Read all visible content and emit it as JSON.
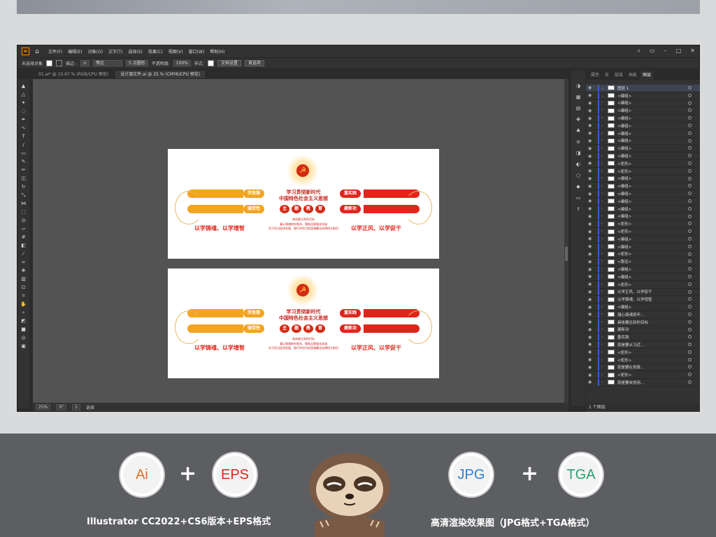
{
  "menu": [
    "文件(F)",
    "编辑(E)",
    "对象(O)",
    "文字(T)",
    "选择(S)",
    "效果(C)",
    "视图(V)",
    "窗口(W)",
    "帮助(H)"
  ],
  "control": {
    "none_selected": "未选择对象",
    "stroke": "描边 :",
    "stroke_val": "≎",
    "opacity_label": "不透明度:",
    "opacity": "100%",
    "style": "样式:",
    "brush": "5 点圆形",
    "uniform": "等比",
    "doc_setup": "文档设置",
    "prefs": "首选项"
  },
  "tabs": [
    "01.ai* @ 15.67 % (RGB/CPU 预览)",
    "设计源文件.ai @ 25 % (CMYK/CPU 预览)"
  ],
  "status": {
    "zoom": "25%",
    "angle": "0°",
    "page": "1",
    "mode": "选择"
  },
  "panel": {
    "tabs": [
      "属性",
      "库",
      "链接",
      "画板",
      "图层"
    ],
    "footer": "1 个图层"
  },
  "layers": [
    "图层 1",
    "<编组>",
    "<编组>",
    "<编组>",
    "<编组>",
    "<编组>",
    "<编组>",
    "<编组>",
    "<编组>",
    "<编组>",
    "<矩形>",
    "<矩形>",
    "<编组>",
    "<编组>",
    "<编组>",
    "<编组>",
    "<编组>",
    "<编组>",
    "<矩形>",
    "<矩形>",
    "<编组>",
    "<编组>",
    "<矩形>",
    "<路径>",
    "<编组>",
    "<编组>",
    "<矩形>",
    "以学正风、以学促干",
    "以学铸魂、以学增智",
    "<编组>",
    "凝心铸魂筑牢...",
    "具体要达到的目标",
    "建新功",
    "重实践",
    "就是要从习近...",
    "<矩形>",
    "<矩形>",
    "就是要在党政...",
    "<矩形>",
    "就是要自觉用..."
  ],
  "art": {
    "heading1": "学习贯彻新时代",
    "heading2": "中国特色社会主义思想",
    "chips": [
      "主",
      "题",
      "教",
      "育"
    ],
    "tags_left": [
      "学思想",
      "强党性"
    ],
    "tags_right": [
      "重实践",
      "建新功"
    ],
    "slogan_left": "以学铸魂、以学增智",
    "slogan_right": "以学正风、以学促干",
    "goal": "具体要达到的目标",
    "line1": "凝心铸魂筑牢根本、锤炼品格强化忠诚",
    "line2": "实干担当促进发展、践行宗旨为民造福廉洁自律树立新风"
  },
  "bottom": {
    "ai": "Ai",
    "eps": "EPS",
    "jpg": "JPG",
    "tga": "TGA",
    "plus": "+",
    "cap_left": "Illustrator CC2022+CS6版本+EPS格式",
    "cap_right": "高清渲染效果图（JPG格式+TGA格式）"
  },
  "colors": {
    "ai": "#d4732c",
    "eps": "#e0261b",
    "jpg": "#2f7fd1",
    "tga": "#2e9e6f"
  }
}
